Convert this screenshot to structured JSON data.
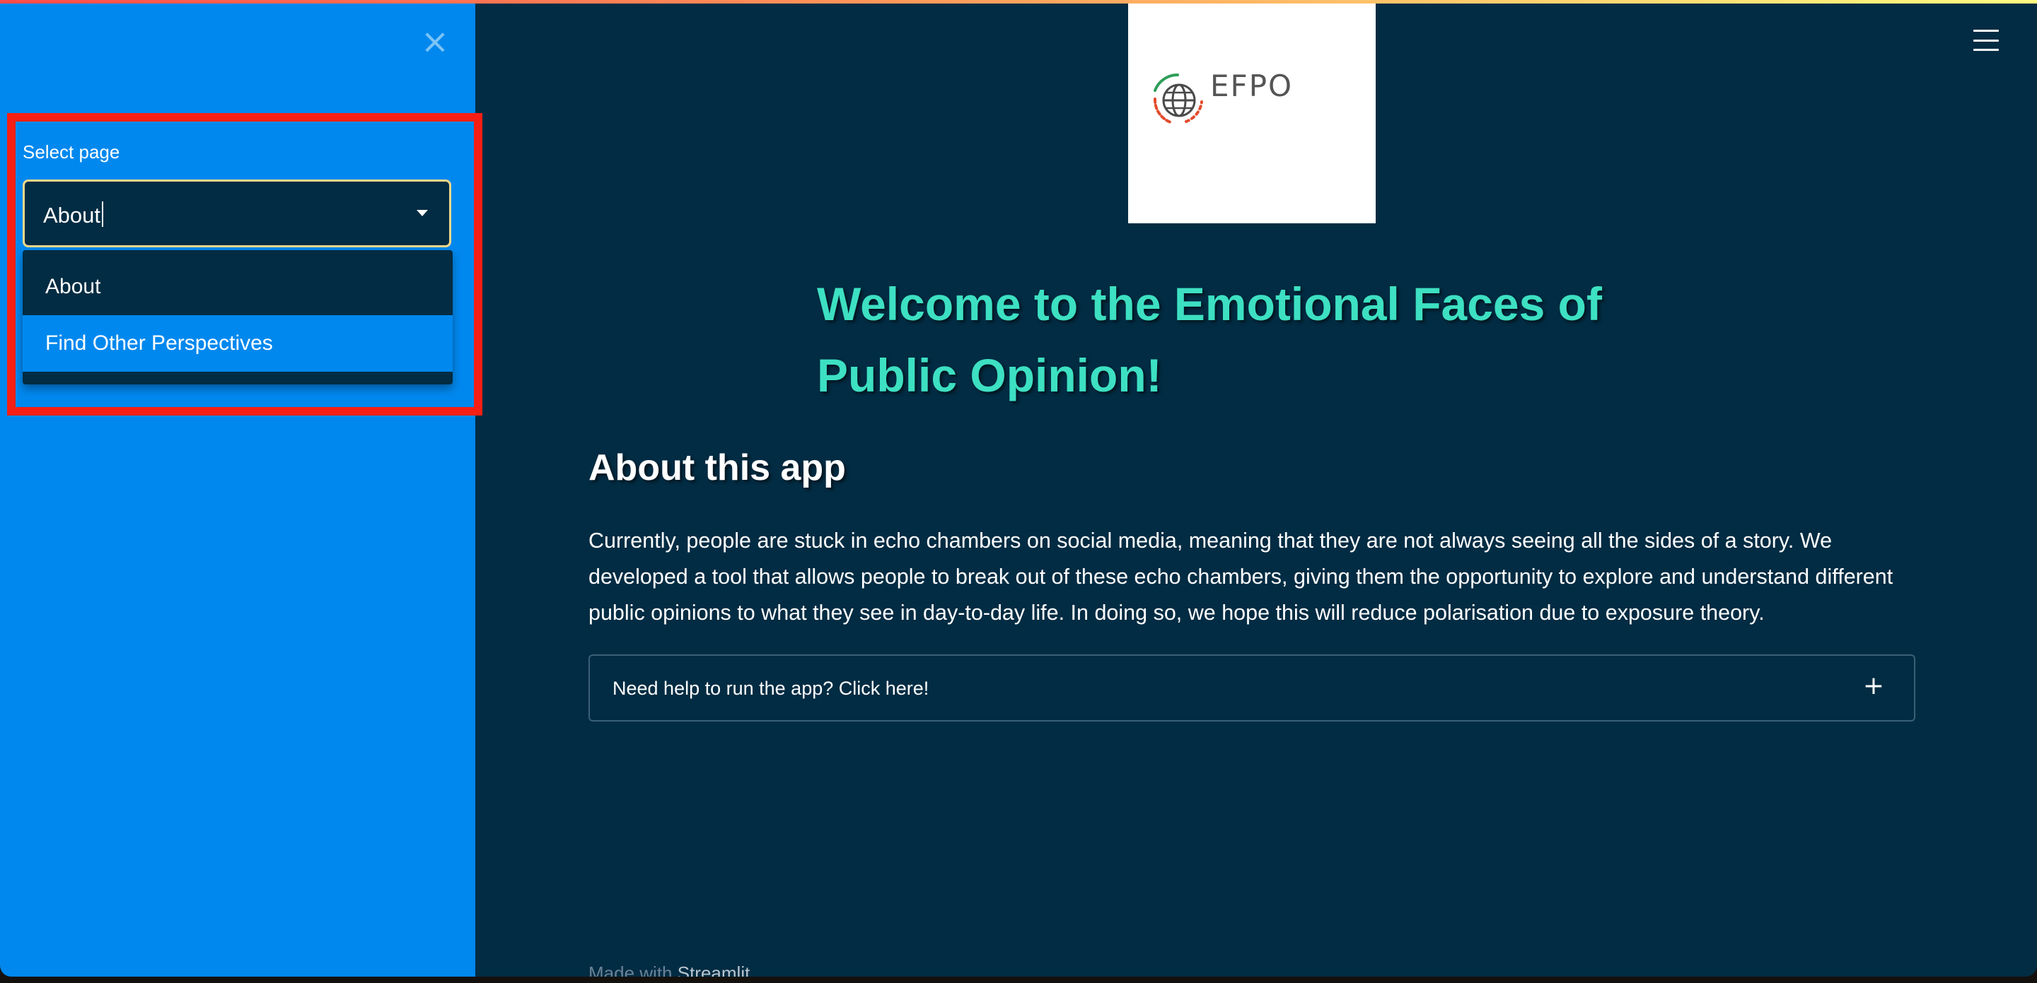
{
  "sidebar": {
    "close_icon": "close-icon",
    "select_label": "Select page",
    "select_value": "About",
    "options": [
      "About",
      "Find Other Perspectives"
    ],
    "highlighted_option": "Find Other Perspectives"
  },
  "logo": {
    "text": "EFPO",
    "icon": "globe-icon"
  },
  "menu_icon": "hamburger-menu-icon",
  "main": {
    "title": "Welcome to the Emotional Faces of Public Opinion!",
    "about_heading": "About this app",
    "about_text": "Currently, people are stuck in echo chambers on social media, meaning that they are not always seeing all the sides of a story. We developed a tool that allows people to break out of these echo chambers, giving them the opportunity to explore and understand different public opinions to what they see in day-to-day life. In doing so, we hope this will reduce polarisation due to exposure theory.",
    "expander_label": "Need help to run the app? Click here!",
    "expander_icon": "plus-icon"
  },
  "footer": {
    "prefix": "Made with",
    "brand": "Streamlit"
  },
  "colors": {
    "sidebar_bg": "#0088ee",
    "main_bg": "#022c43",
    "title_accent": "#3de0c2",
    "select_border": "#f7d98a",
    "annotation_red": "#f71f14"
  }
}
